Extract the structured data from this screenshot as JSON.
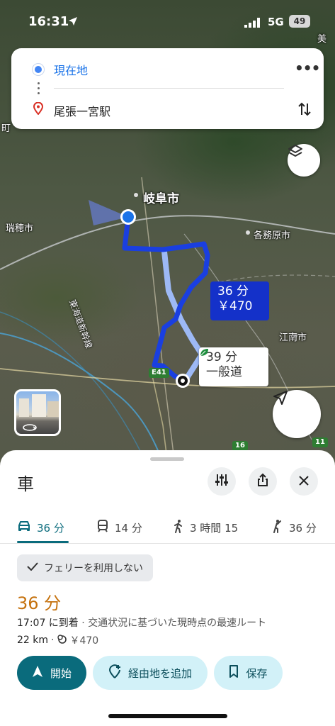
{
  "status_bar": {
    "time": "16:31",
    "network": "5G",
    "battery": "49"
  },
  "route_search": {
    "origin": "現在地",
    "destination": "尾張一宮駅"
  },
  "map": {
    "labels": {
      "gifu": "岐阜市",
      "mizuho": "瑞穂市",
      "kakamigahara": "各務原市",
      "konan": "江南市",
      "bullet_train": "東海道新幹線",
      "mi": "美",
      "machi": "町"
    },
    "route_main": {
      "time": "36 分",
      "toll": "￥470"
    },
    "route_alt": {
      "time": "39 分",
      "road": "一般道"
    },
    "shields": {
      "e41": "E41",
      "r16": "16",
      "r11": "11"
    }
  },
  "sheet": {
    "mode_title": "車",
    "tabs": [
      {
        "label": "36 分",
        "icon": "car-icon"
      },
      {
        "label": "14 分",
        "icon": "train-icon"
      },
      {
        "label": "3 時間 15",
        "icon": "walk-icon"
      },
      {
        "label": "36 分",
        "icon": "ride-icon"
      }
    ],
    "chip_label": "フェリーを利用しない",
    "duration": "36 分",
    "arrival": "17:07 に到着",
    "arrival_note": " · 交通状況に基づいた現時点の最速ルート",
    "distance": "22 km",
    "toll": "￥470",
    "start_label": "開始",
    "waypoint_label": "経由地を追加",
    "save_label": "保存"
  },
  "colors": {
    "accent": "#0a6b7c",
    "route_primary": "#1a3fe0",
    "route_alt": "#9db9f5",
    "duration": "#c5720f"
  }
}
